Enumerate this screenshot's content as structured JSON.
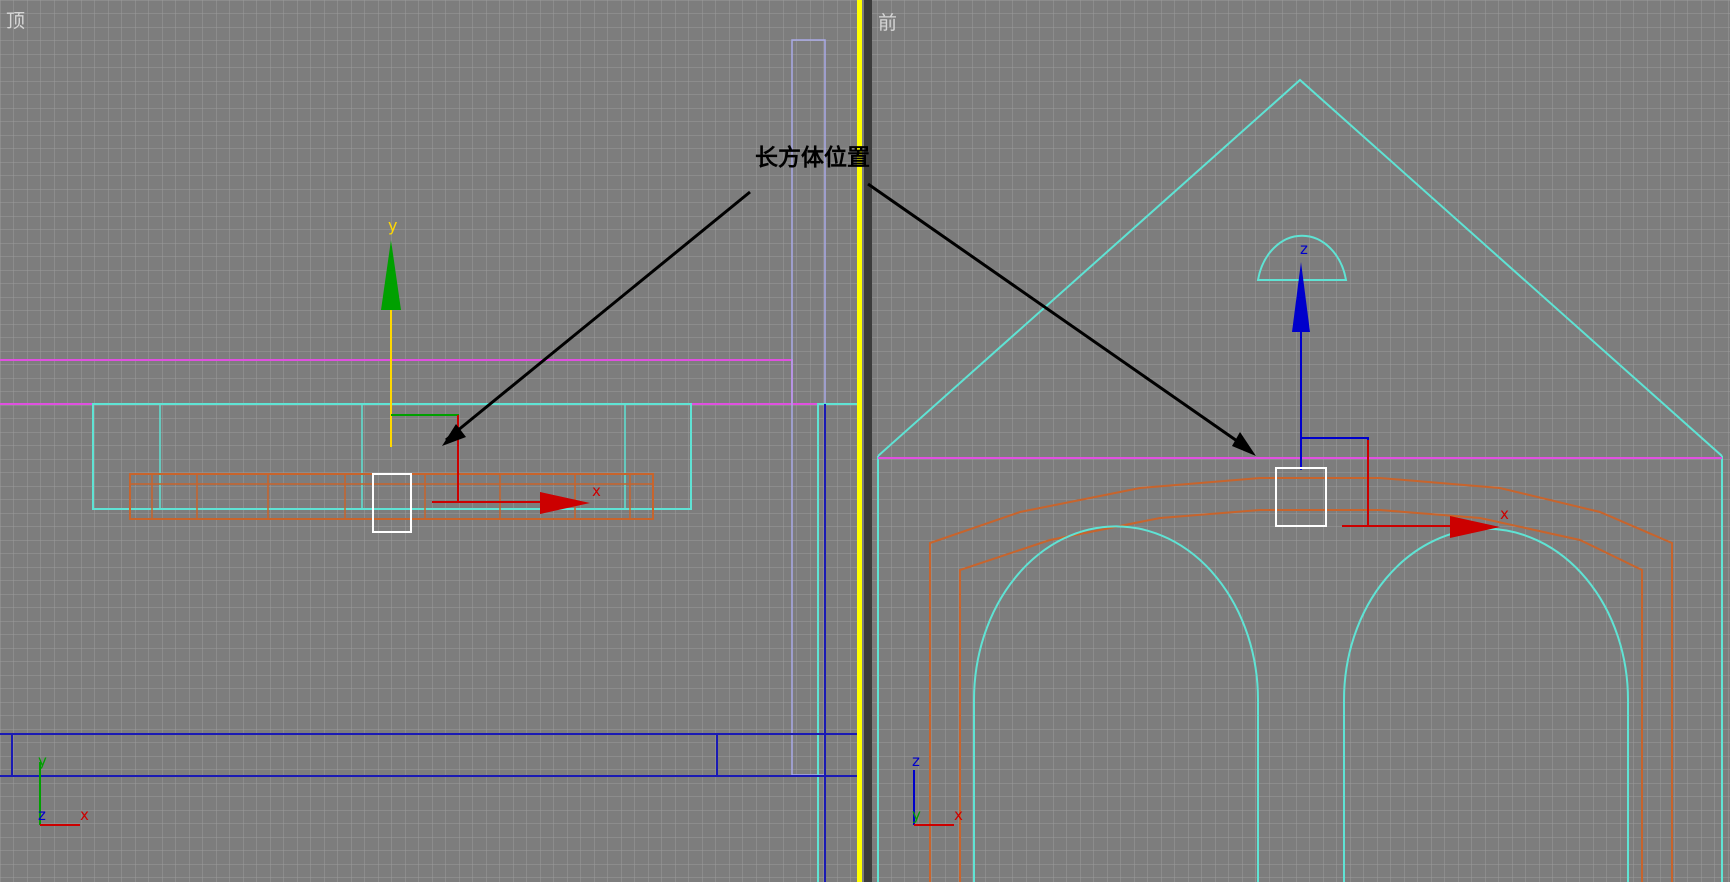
{
  "viewports": {
    "top": {
      "label": "顶"
    },
    "front": {
      "label": "前"
    }
  },
  "annotation": {
    "text": "长方体位置"
  },
  "gizmo_top": {
    "y_label": "y",
    "x_label": "x"
  },
  "gizmo_front": {
    "z_label": "z",
    "x_label": "x"
  },
  "axis_tripod_top": {
    "y_label": "y",
    "z_label": "z",
    "x_label": "x"
  },
  "axis_tripod_front": {
    "z_label": "z",
    "y_label": "y",
    "x_label": "x"
  },
  "colors": {
    "viewport_bg": "#7d7d7d",
    "grid": "#9b9b9b",
    "grid_major": "#5c5c5c",
    "divider_active": "#ffff00",
    "cyan_lines": "#5fe3d4",
    "orange_lines": "#c8642c",
    "magenta_lines": "#e050e0",
    "blue_lines": "#1a1ab4",
    "gizmo_x": "#cc0000",
    "gizmo_y": "#00a000",
    "gizmo_z": "#0000cc",
    "gizmo_y_label": "#ffd800"
  }
}
